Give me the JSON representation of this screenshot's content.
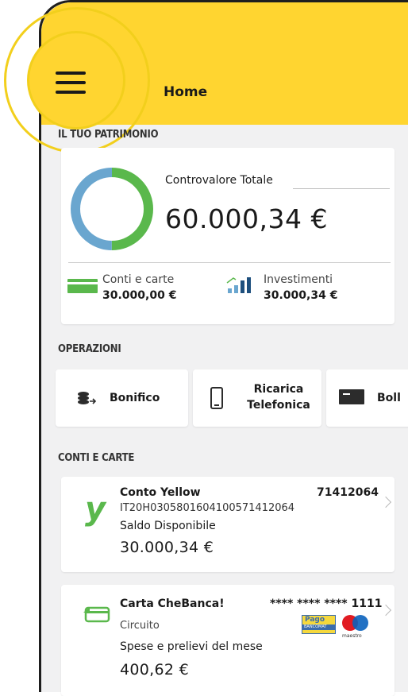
{
  "header": {
    "title": "Home",
    "menu_icon": "hamburger-icon",
    "accent": "#ffd530"
  },
  "patrimonio": {
    "section_label": "IL TUO PATRIMONIO",
    "total_label": "Controvalore Totale",
    "total_value": "60.000,34 €",
    "donut": {
      "green_fraction": 0.5,
      "blue_fraction": 0.5,
      "green": "#5ab84c",
      "blue": "#6aa6cf"
    },
    "conti": {
      "label": "Conti e carte",
      "value": "30.000,00 €",
      "icon": "card-icon"
    },
    "investimenti": {
      "label": "Investimenti",
      "value": "30.000,34 €",
      "icon": "chart-up-icon"
    }
  },
  "operazioni": {
    "section_label": "OPERAZIONI",
    "items": [
      {
        "label": "Bonifico",
        "icon": "coins-transfer-icon"
      },
      {
        "label_line1": "Ricarica",
        "label_line2": "Telefonica",
        "icon": "phone-icon"
      },
      {
        "label": "Boll",
        "icon": "bill-icon"
      }
    ]
  },
  "conti_carte": {
    "section_label": "CONTI E CARTE",
    "account": {
      "name": "Conto Yellow",
      "number": "71412064",
      "iban": "IT20H0305801604100571412064",
      "balance_label": "Saldo Disponibile",
      "balance": "30.000,34 €",
      "logo": "y"
    },
    "card": {
      "name": "Carta CheBanca!",
      "masked_number": "**** **** **** 1111",
      "circuit_label": "Circuito",
      "spend_label": "Spese e prelievi del mese",
      "spend_value": "400,62 €",
      "pagobancomat": "Pago",
      "pagobancomat_sub": "BANCOMAT",
      "maestro": "maestro"
    }
  }
}
